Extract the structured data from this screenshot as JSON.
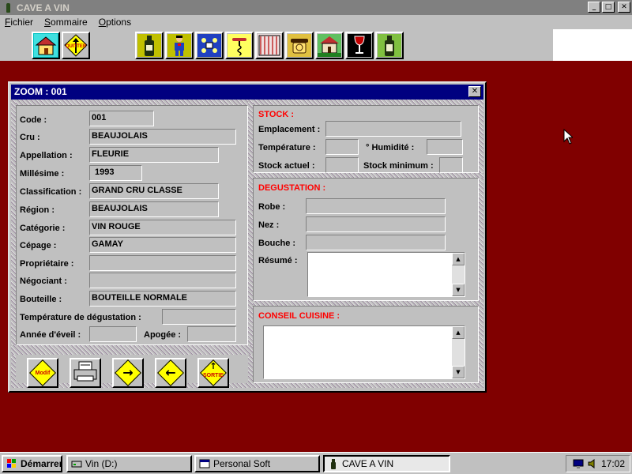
{
  "app": {
    "title": "CAVE A VIN",
    "controls": {
      "minimize": "_",
      "maximize": "□",
      "close": "✕"
    }
  },
  "menu": {
    "items": [
      "Fichier",
      "Sommaire",
      "Options"
    ]
  },
  "toolbar": {
    "quit_label": "QUITTER",
    "icons": [
      "house-icon",
      "quit-sign-icon",
      "wine-bottle-icon",
      "person-icon",
      "cellar-rack-icon",
      "corkscrew-icon",
      "wine-list-icon",
      "telephone-icon",
      "chateau-icon",
      "wine-glass-icon",
      "wine-label-icon"
    ]
  },
  "zoom": {
    "title": "ZOOM : 001",
    "close_glyph": "✕",
    "fields": {
      "code": {
        "label": "Code :",
        "value": "001"
      },
      "cru": {
        "label": "Cru :",
        "value": "BEAUJOLAIS"
      },
      "appellation": {
        "label": "Appellation :",
        "value": "FLEURIE"
      },
      "millesime": {
        "label": "Millésime :",
        "value": "1993"
      },
      "classification": {
        "label": "Classification :",
        "value": "GRAND CRU CLASSE"
      },
      "region": {
        "label": "Région :",
        "value": "BEAUJOLAIS"
      },
      "categorie": {
        "label": "Catégorie :",
        "value": "VIN ROUGE"
      },
      "cepage": {
        "label": "Cépage :",
        "value": "GAMAY"
      },
      "proprietaire": {
        "label": "Propriétaire :",
        "value": ""
      },
      "negociant": {
        "label": "Négociant :",
        "value": ""
      },
      "bouteille": {
        "label": "Bouteille :",
        "value": "BOUTEILLE NORMALE"
      },
      "temp_degustation": {
        "label": "Température de dégustation :",
        "value": ""
      },
      "annee_eveil": {
        "label": "Année d'éveil :",
        "value": ""
      },
      "apogee": {
        "label": "Apogée :",
        "value": ""
      }
    },
    "stock": {
      "title": "STOCK :",
      "emplacement": {
        "label": "Emplacement :",
        "value": ""
      },
      "temperature": {
        "label": "Température :",
        "value": ""
      },
      "humidite": {
        "label": "° Humidité :",
        "value": ""
      },
      "stock_actuel": {
        "label": "Stock actuel :",
        "value": ""
      },
      "stock_minimum": {
        "label": "Stock minimum :",
        "value": ""
      }
    },
    "degustation": {
      "title": "DEGUSTATION :",
      "robe": {
        "label": "Robe :",
        "value": ""
      },
      "nez": {
        "label": "Nez :",
        "value": ""
      },
      "bouche": {
        "label": "Bouche :",
        "value": ""
      },
      "resume": {
        "label": "Résumé :",
        "value": ""
      }
    },
    "conseil": {
      "title": "CONSEIL CUISINE :",
      "value": ""
    },
    "buttons": {
      "modif": "Modif",
      "sortie": "SORTIE"
    }
  },
  "taskbar": {
    "start": "Démarrer",
    "tasks": [
      "Vin (D:)",
      "Personal Soft",
      "CAVE A VIN"
    ],
    "clock": "17:02"
  },
  "colors": {
    "desktop": "#800000",
    "dialog_title": "#000080",
    "section_title": "#ff0000"
  }
}
